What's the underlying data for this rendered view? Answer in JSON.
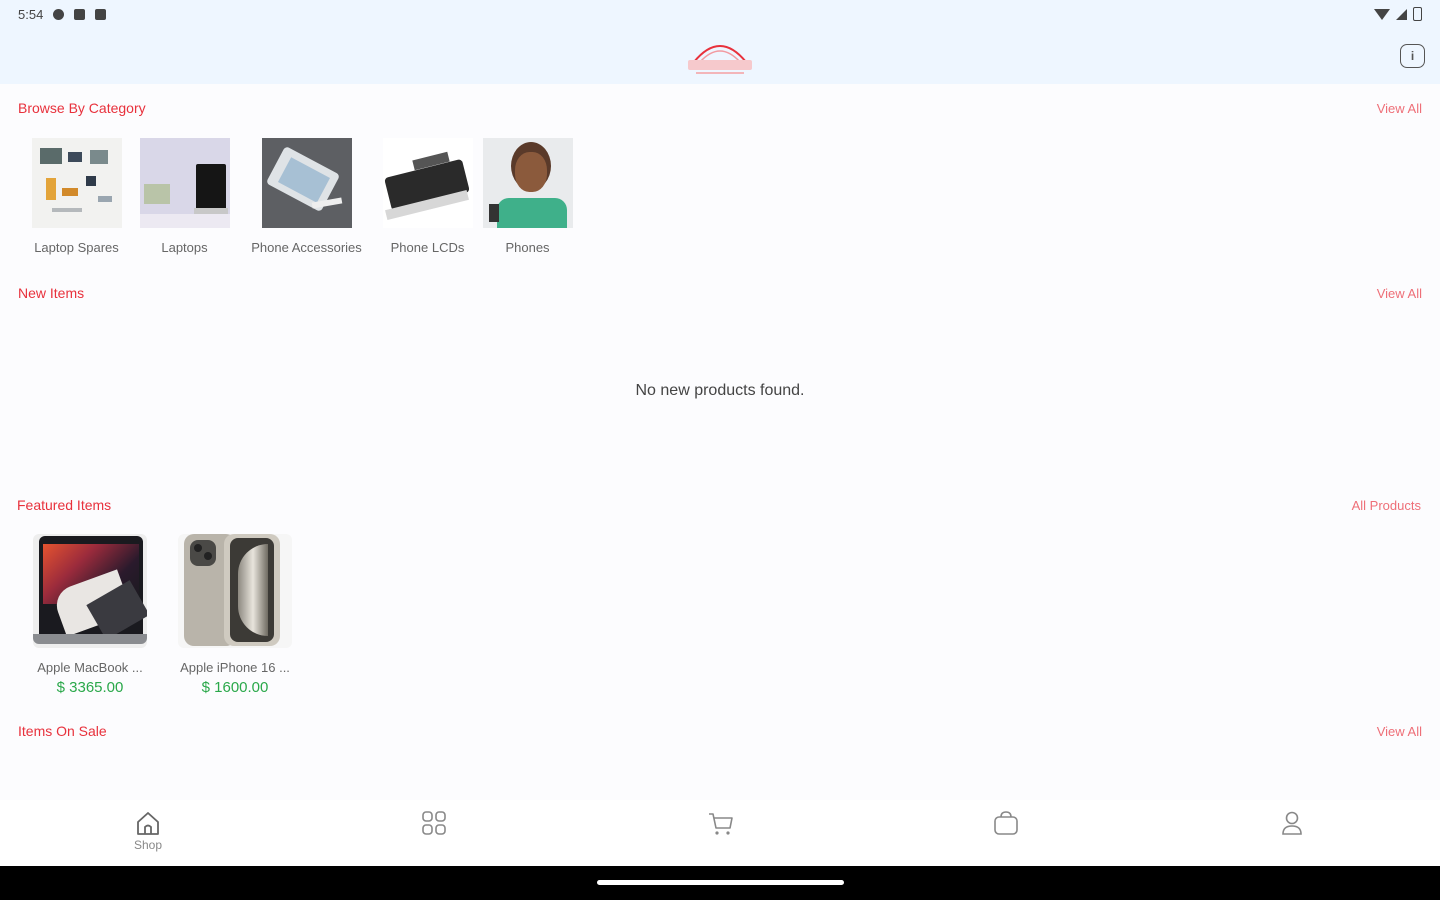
{
  "status_bar": {
    "time": "5:54"
  },
  "header": {
    "info_icon": "info-icon"
  },
  "categories": {
    "title": "Browse By Category",
    "view_all": "View All",
    "items": [
      {
        "label": "Laptop Spares"
      },
      {
        "label": "Laptops"
      },
      {
        "label": "Phone Accessories"
      },
      {
        "label": "Phone LCDs"
      },
      {
        "label": "Phones"
      }
    ]
  },
  "new_items": {
    "title": "New Items",
    "view_all": "View All",
    "empty_message": "No new products found."
  },
  "featured": {
    "title": "Featured Items",
    "view_all": "All Products",
    "items": [
      {
        "name": "Apple MacBook ...",
        "price": "$ 3365.00"
      },
      {
        "name": "Apple iPhone 16 ...",
        "price": "$ 1600.00"
      }
    ]
  },
  "on_sale": {
    "title": "Items On Sale",
    "view_all": "View All"
  },
  "bottom_nav": {
    "items": [
      {
        "icon": "home-icon",
        "label": "Shop"
      },
      {
        "icon": "grid-icon",
        "label": ""
      },
      {
        "icon": "cart-icon",
        "label": ""
      },
      {
        "icon": "bag-icon",
        "label": ""
      },
      {
        "icon": "user-icon",
        "label": ""
      }
    ]
  },
  "colors": {
    "accent": "#e8313c",
    "price": "#2aa84a",
    "header_bg": "#eef6ff"
  }
}
